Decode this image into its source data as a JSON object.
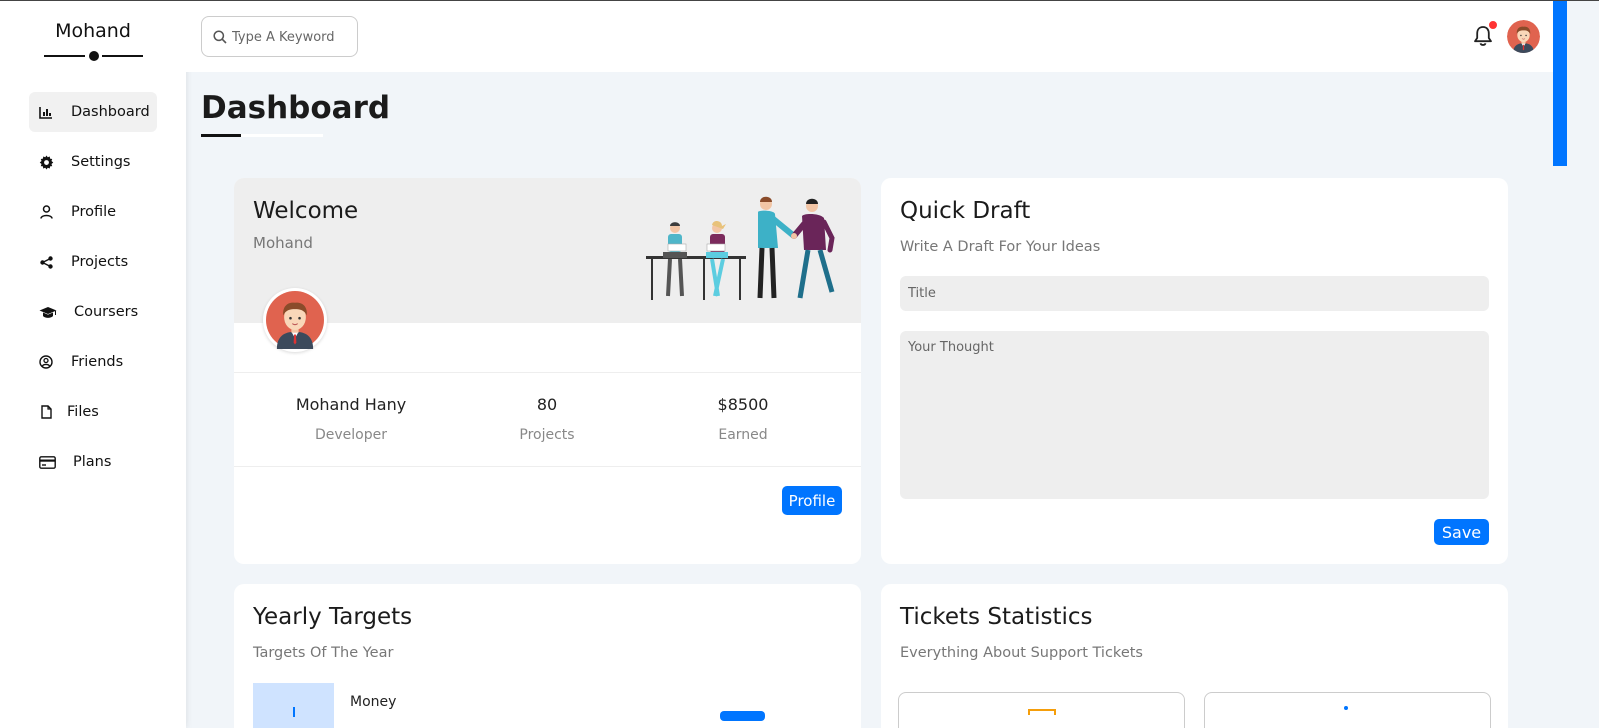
{
  "brand": "Mohand",
  "sidebar": {
    "items": [
      {
        "label": "Dashboard",
        "icon": "chart-icon"
      },
      {
        "label": "Settings",
        "icon": "gear-icon"
      },
      {
        "label": "Profile",
        "icon": "user-icon"
      },
      {
        "label": "Projects",
        "icon": "share-icon"
      },
      {
        "label": "Coursers",
        "icon": "graduation-cap-icon"
      },
      {
        "label": "Friends",
        "icon": "user-circle-icon"
      },
      {
        "label": "Files",
        "icon": "file-icon"
      },
      {
        "label": "Plans",
        "icon": "credit-card-icon"
      }
    ]
  },
  "search": {
    "placeholder": "Type A Keyword"
  },
  "page_title": "Dashboard",
  "welcome": {
    "title": "Welcome",
    "name": "Mohand",
    "stats": [
      {
        "value": "Mohand Hany",
        "label": "Developer"
      },
      {
        "value": "80",
        "label": "Projects"
      },
      {
        "value": "$8500",
        "label": "Earned"
      }
    ],
    "button": "Profile"
  },
  "draft": {
    "title": "Quick Draft",
    "subtitle": "Write A Draft For Your Ideas",
    "title_placeholder": "Title",
    "body_placeholder": "Your Thought",
    "button": "Save"
  },
  "targets": {
    "title": "Yearly Targets",
    "subtitle": "Targets Of The Year",
    "first_label": "Money"
  },
  "tickets": {
    "title": "Tickets Statistics",
    "subtitle": "Everything About Support Tickets"
  },
  "colors": {
    "accent": "#0075ff",
    "notification": "#f33333",
    "background": "#f1f5f9"
  }
}
